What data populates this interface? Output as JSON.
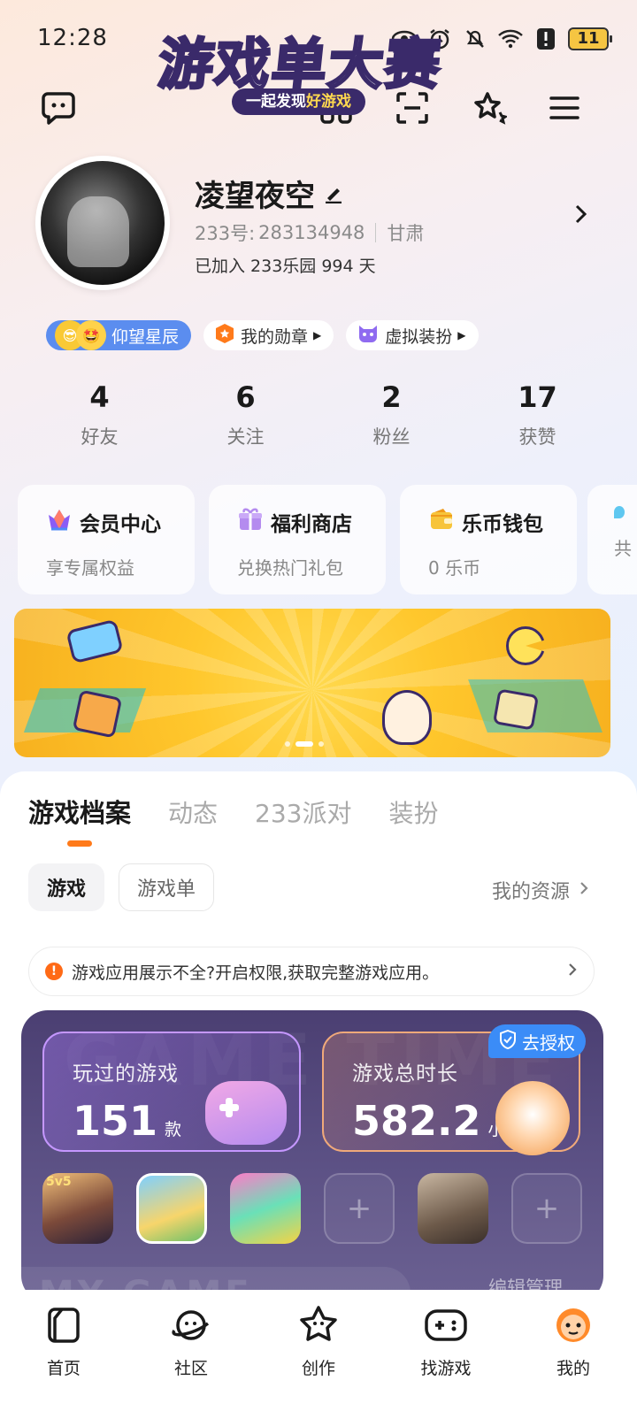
{
  "status_bar": {
    "time": "12:28",
    "battery": "11"
  },
  "profile": {
    "name": "凌望夜空",
    "id_label": "233号:",
    "id_value": "283134948",
    "region": "甘肃",
    "joined": "已加入 233乐园 994 天"
  },
  "badges": [
    {
      "label": "仰望星辰"
    },
    {
      "label": "我的勋章"
    },
    {
      "label": "虚拟装扮"
    }
  ],
  "stats": [
    {
      "value": "4",
      "label": "好友"
    },
    {
      "value": "6",
      "label": "关注"
    },
    {
      "value": "2",
      "label": "粉丝"
    },
    {
      "value": "17",
      "label": "获赞"
    }
  ],
  "services": [
    {
      "title": "会员中心",
      "subtitle": "享专属权益"
    },
    {
      "title": "福利商店",
      "subtitle": "兑换热门礼包"
    },
    {
      "title": "乐币钱包",
      "subtitle": "0 乐币"
    },
    {
      "title": "",
      "subtitle": "共"
    }
  ],
  "banner": {
    "title": "游戏单大赛",
    "subtitle_prefix": "一起发现",
    "subtitle_highlight": "好游戏"
  },
  "tabs": [
    "游戏档案",
    "动态",
    "233派对",
    "装扮"
  ],
  "filters": {
    "active": "游戏",
    "inactive": "游戏单",
    "resources": "我的资源"
  },
  "notice": "游戏应用展示不全?开启权限,获取完整游戏应用。",
  "game_stats": {
    "played_label": "玩过的游戏",
    "played_value": "151",
    "played_unit": "款",
    "time_label": "游戏总时长",
    "time_value": "582.2",
    "time_unit": "小时",
    "auth_button": "去授权",
    "watermark": "GAME TIME",
    "edit": "编辑管理",
    "my_game": "MY GAME",
    "icon_tag": "5v5"
  },
  "nav": [
    "首页",
    "社区",
    "创作",
    "找游戏",
    "我的"
  ],
  "colors": {
    "accent": "#ff7a1a",
    "badge_blue": "#5b8def",
    "auth_blue": "#3b8cf7"
  }
}
